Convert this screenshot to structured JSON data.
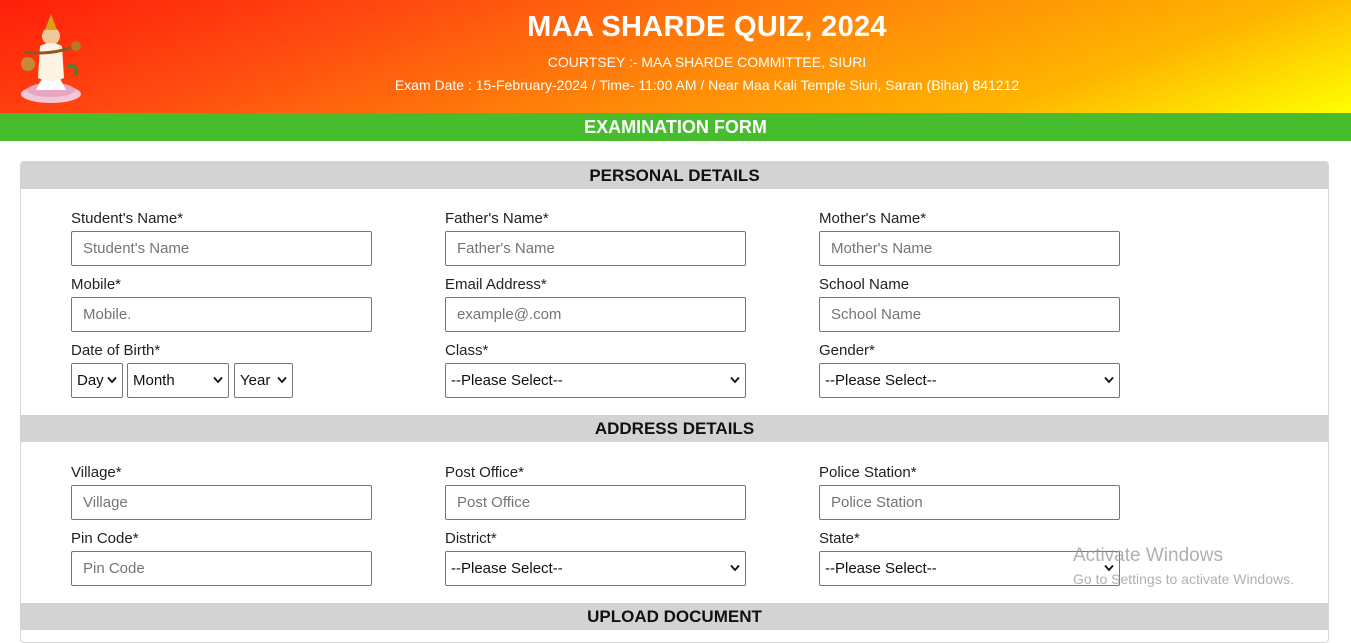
{
  "header": {
    "title": "MAA SHARDE QUIZ, 2024",
    "courtesy": "COURTSEY :- MAA SHARDE COMMITTEE, SIURI",
    "exam_info": "Exam Date : 15-February-2024 / Time- 11:00 AM / Near Maa Kali Temple Siuri, Saran (Bihar) 841212",
    "logo_icon": "saraswati-logo-icon"
  },
  "form_bar": {
    "title": "EXAMINATION FORM"
  },
  "personal": {
    "heading": "PERSONAL DETAILS",
    "student_name": {
      "label": "Student's Name*",
      "placeholder": "Student's Name"
    },
    "father_name": {
      "label": "Father's Name*",
      "placeholder": "Father's Name"
    },
    "mother_name": {
      "label": "Mother's Name*",
      "placeholder": "Mother's Name"
    },
    "mobile": {
      "label": "Mobile*",
      "placeholder": "Mobile."
    },
    "email": {
      "label": "Email Address*",
      "placeholder": "example@.com"
    },
    "school": {
      "label": "School Name",
      "placeholder": "School Name"
    },
    "dob": {
      "label": "Date of Birth*",
      "day": "Day",
      "month": "Month",
      "year": "Year"
    },
    "class": {
      "label": "Class*",
      "selected": "--Please Select--"
    },
    "gender": {
      "label": "Gender*",
      "selected": "--Please Select--"
    }
  },
  "address": {
    "heading": "ADDRESS DETAILS",
    "village": {
      "label": "Village*",
      "placeholder": "Village"
    },
    "post_office": {
      "label": "Post Office*",
      "placeholder": "Post Office"
    },
    "police_station": {
      "label": "Police Station*",
      "placeholder": "Police Station"
    },
    "pin_code": {
      "label": "Pin Code*",
      "placeholder": "Pin Code"
    },
    "district": {
      "label": "District*",
      "selected": "--Please Select--"
    },
    "state": {
      "label": "State*",
      "selected": "--Please Select--"
    }
  },
  "upload": {
    "heading": "UPLOAD DOCUMENT"
  },
  "watermark": {
    "line1": "Activate Windows",
    "line2": "Go to Settings to activate Windows."
  },
  "colors": {
    "banner_gradient": [
      "#ff1e0a",
      "#ff8a08",
      "#ffff00"
    ],
    "form_bar": "#47bd2e",
    "section_head": "#d3d3d3"
  }
}
